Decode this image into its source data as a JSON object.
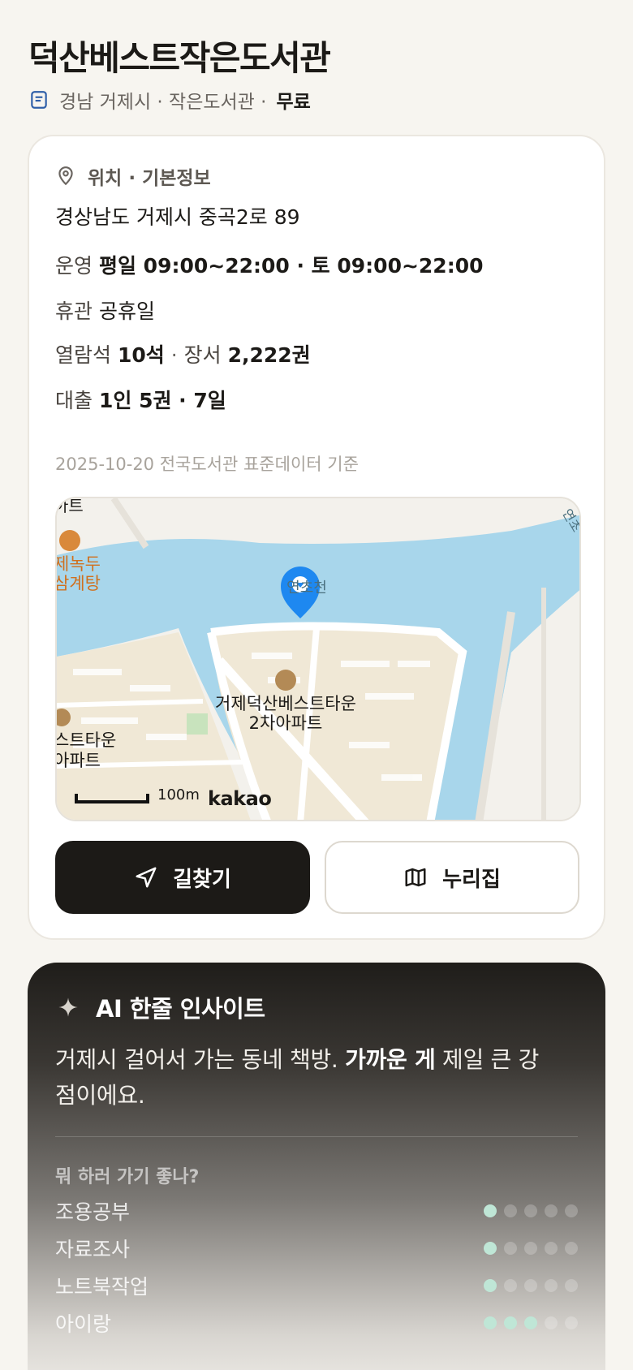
{
  "title": "덕산베스트작은도서관",
  "subtitle": {
    "region": "경남 거제시 · 작은도서관 ·",
    "fee": "무료"
  },
  "info": {
    "header": "위치 · 기본정보",
    "address": "경상남도 거제시 중곡2로 89",
    "hours_label": "운영",
    "hours_value": "평일 09:00~22:00 · 토 09:00~22:00",
    "closed_label": "휴관",
    "closed_value": "공휴일",
    "seats_label": "열람석",
    "seats_value": "10석",
    "books_label": "장서",
    "books_value": "2,222권",
    "loan_label": "대출",
    "loan_value": "1인 5권 · 7일",
    "as_of": "2025-10-20 전국도서관 표준데이터 기준"
  },
  "map": {
    "labels": {
      "river": "연초천",
      "river2": "연초",
      "apt_main_1": "거제덕산베스트타운",
      "apt_main_2": "2차아파트",
      "apt_left_1": "스트타운",
      "apt_left_2": "아파트",
      "rest_1": "제녹두",
      "rest_2": "삼계탕",
      "top_left": "아트"
    },
    "scale": "100m",
    "provider": "kakao"
  },
  "buttons": {
    "directions": "길찾기",
    "nurijip": "누리집"
  },
  "ai": {
    "header": "AI 한줄 인사이트",
    "text_a": "거제시 걸어서 가는 동네 책방. ",
    "text_bold": "가까운 게",
    "text_b": " 제일 큰 강점이에요.",
    "question": "뭐 하러 가기 좋나?",
    "activities": [
      {
        "label": "조용공부",
        "score": 1
      },
      {
        "label": "자료조사",
        "score": 1
      },
      {
        "label": "노트북작업",
        "score": 1
      },
      {
        "label": "아이랑",
        "score": 3
      }
    ],
    "accent": "#bfe6d6"
  }
}
